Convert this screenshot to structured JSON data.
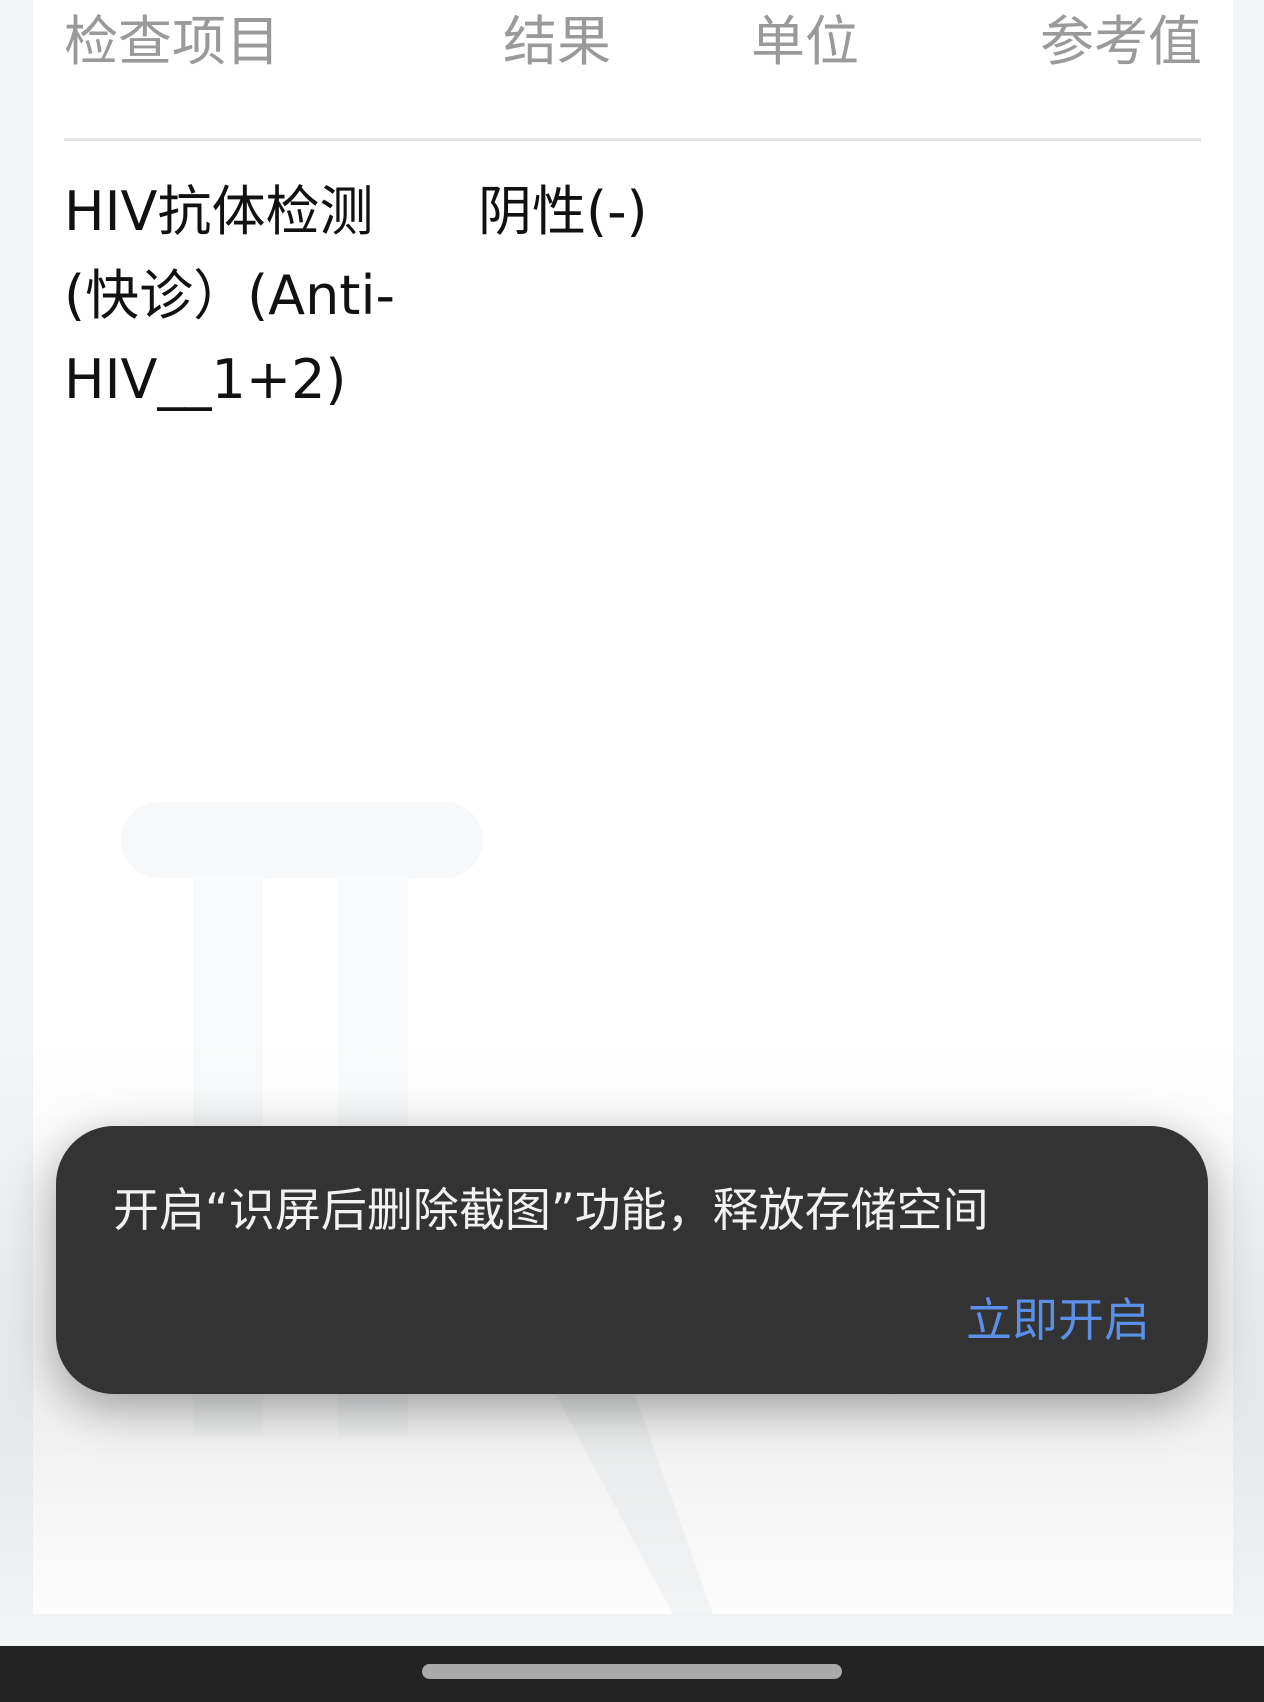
{
  "table": {
    "headers": {
      "item": "检查项目",
      "result": "结果",
      "unit": "单位",
      "reference": "参考值"
    },
    "rows": [
      {
        "item": "HIV抗体检测(快诊）(Anti-HIV__1+2)",
        "result": "阴性(-)",
        "unit": "",
        "reference": ""
      }
    ]
  },
  "toast": {
    "message": "开启“识屏后删除截图”功能，释放存储空间",
    "action_label": "立即开启",
    "action_color": "#5a8fea",
    "background_color": "#333333"
  },
  "nav_bar": {
    "home_indicator": "home-indicator"
  }
}
